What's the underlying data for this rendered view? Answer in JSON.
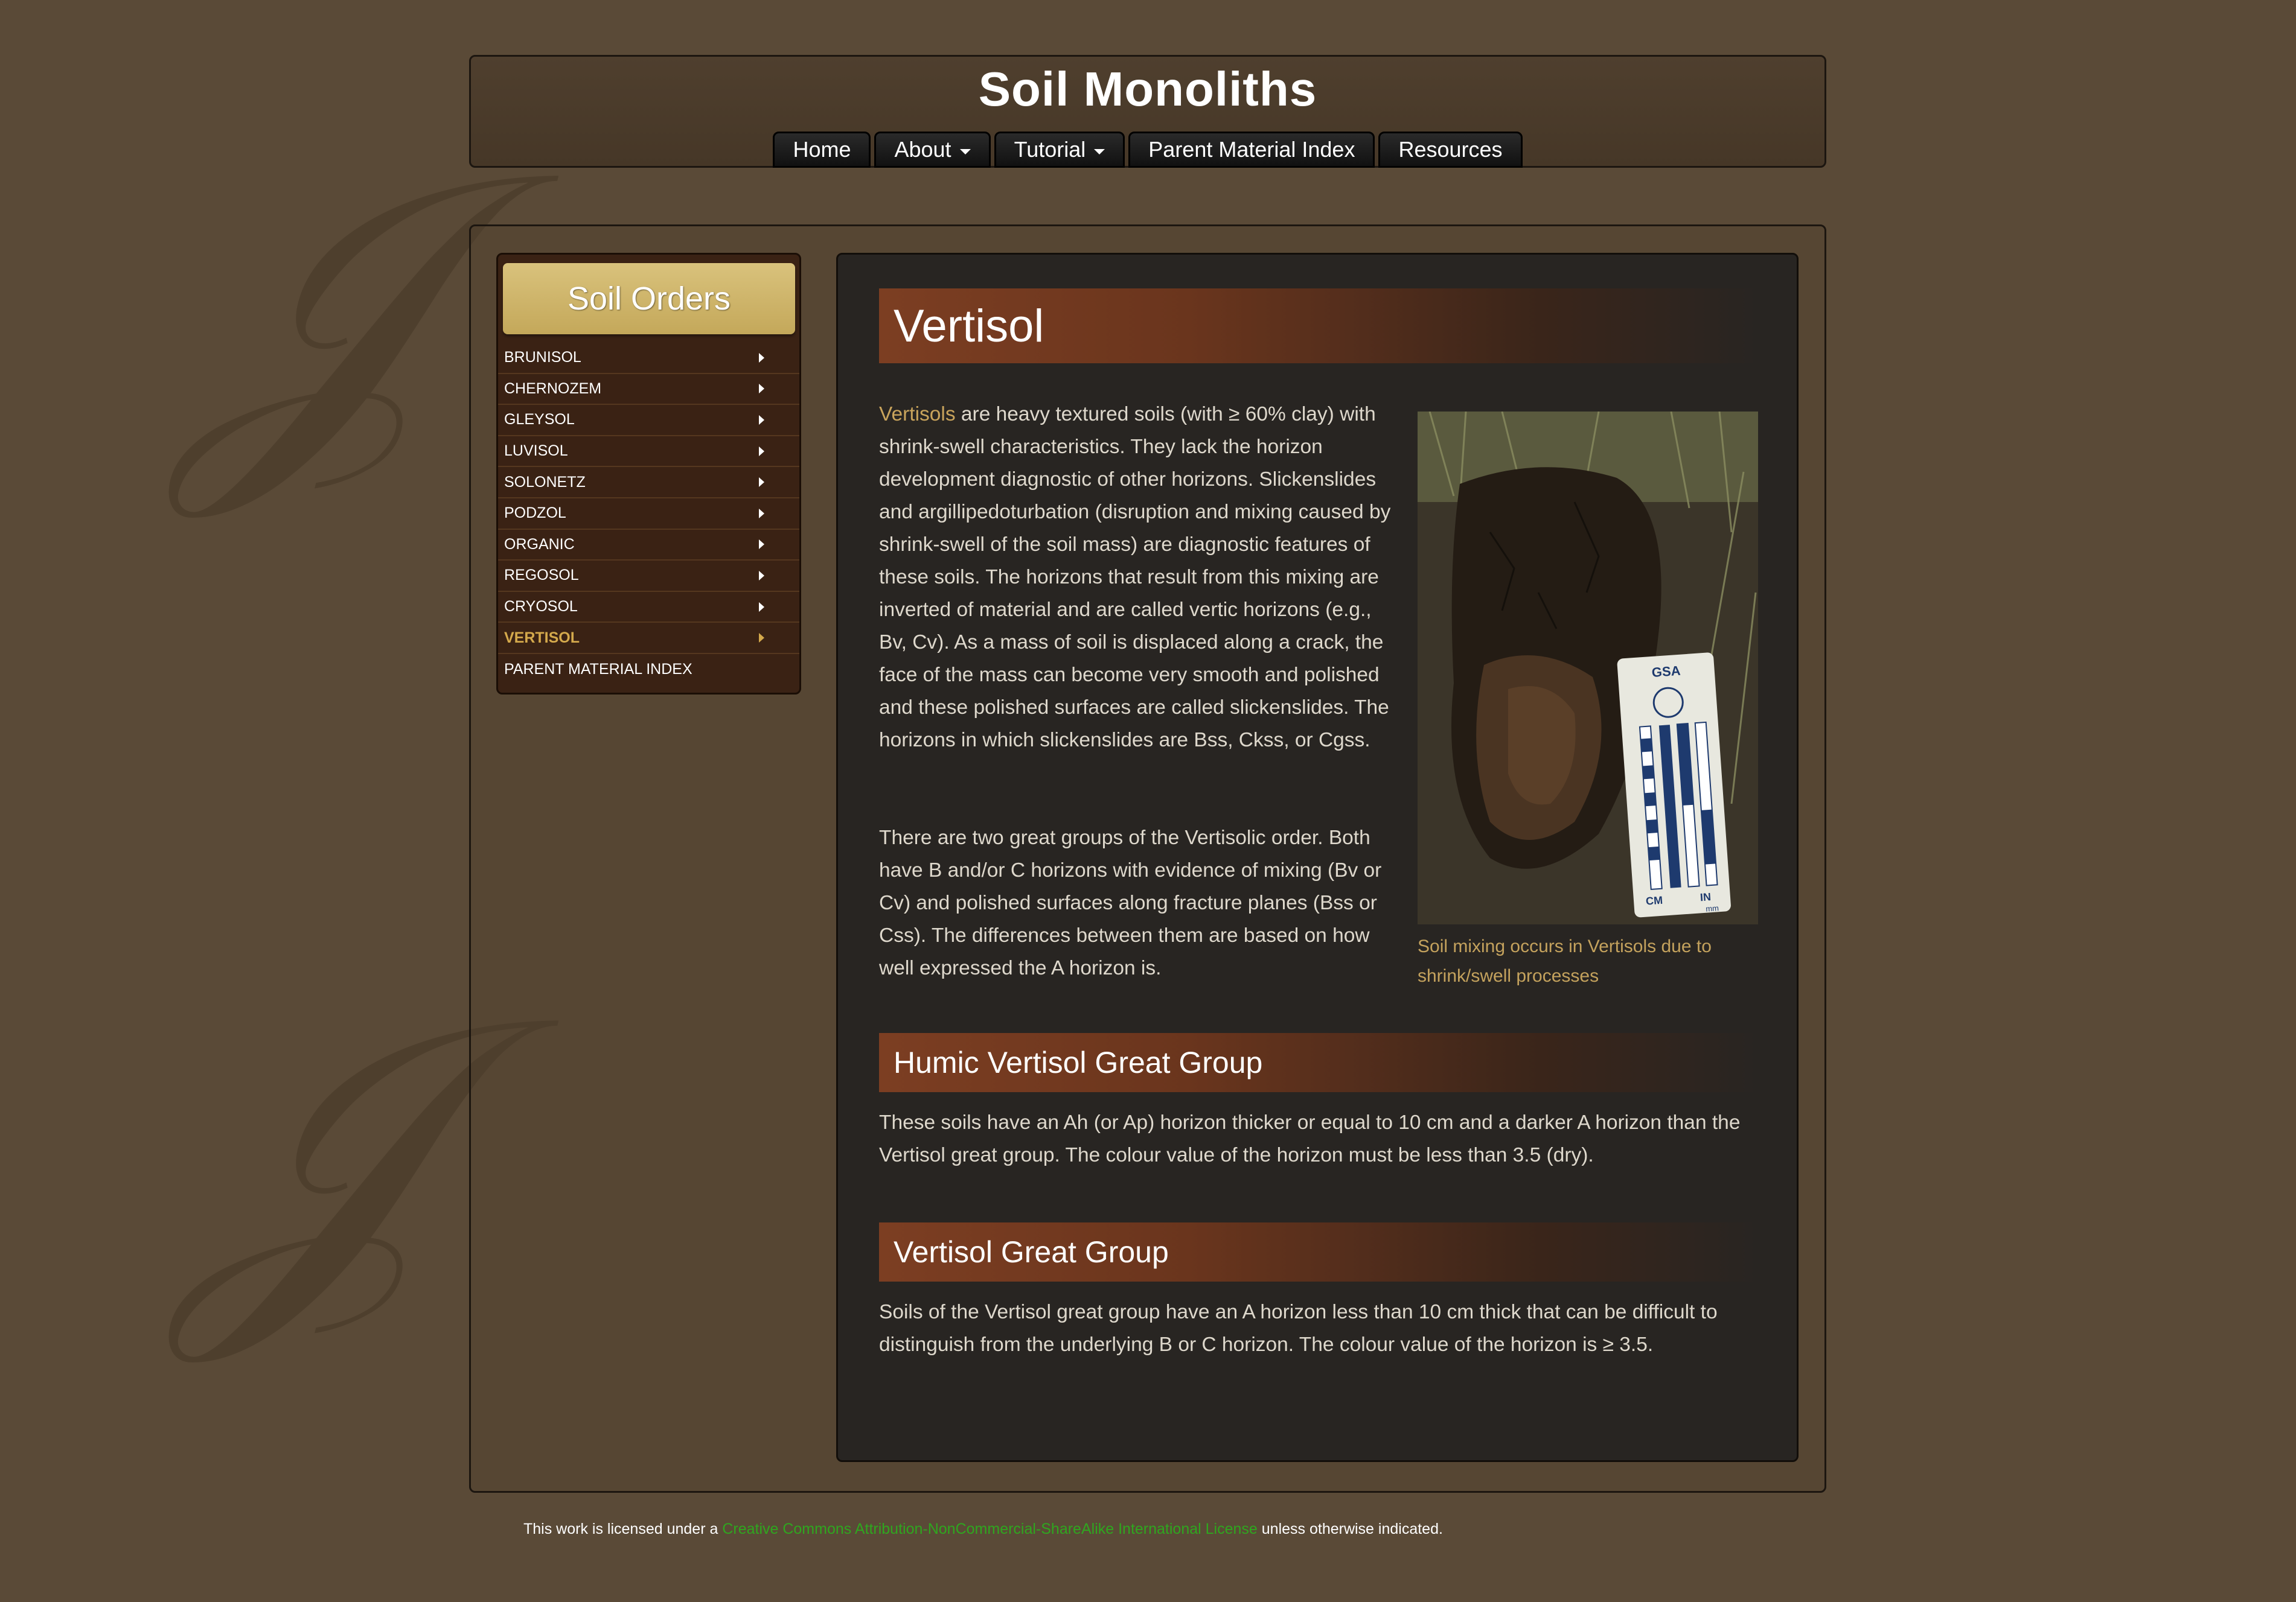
{
  "site": {
    "title": "Soil Monoliths"
  },
  "nav": {
    "items": [
      {
        "label": "Home",
        "dropdown": false
      },
      {
        "label": "About",
        "dropdown": true
      },
      {
        "label": "Tutorial",
        "dropdown": true
      },
      {
        "label": "Parent Material Index",
        "dropdown": false
      },
      {
        "label": "Resources",
        "dropdown": false
      }
    ]
  },
  "sidebar": {
    "heading": "Soil Orders",
    "items": [
      {
        "label": "BRUNISOL",
        "active": false
      },
      {
        "label": "CHERNOZEM",
        "active": false
      },
      {
        "label": "GLEYSOL",
        "active": false
      },
      {
        "label": "LUVISOL",
        "active": false
      },
      {
        "label": "SOLONETZ",
        "active": false
      },
      {
        "label": "PODZOL",
        "active": false
      },
      {
        "label": "ORGANIC",
        "active": false
      },
      {
        "label": "REGOSOL",
        "active": false
      },
      {
        "label": "CRYOSOL",
        "active": false
      },
      {
        "label": "VERTISOL",
        "active": true
      },
      {
        "label": "PARENT MATERIAL INDEX",
        "active": false
      }
    ]
  },
  "content": {
    "title": "Vertisol",
    "intro_link": "Vertisols",
    "intro_rest": " are heavy textured soils (with ≥ 60% clay) with shrink-swell characteristics.  They lack the horizon development diagnostic of other horizons.  Slickenslides and argillipedoturbation (disruption and mixing caused by shrink-swell of the soil mass) are diagnostic features of these soils. The horizons that result from this mixing are inverted of material and are called vertic horizons (e.g., Bv, Cv). As a mass of soil is displaced along a crack, the face of the mass can become very smooth and polished and these polished surfaces are called slickenslides. The horizons in which slickenslides are Bss, Ckss, or Cgss.",
    "para2": "There are two great groups of the Vertisolic order. Both have B and/or C horizons with evidence of mixing (Bv or Cv) and polished surfaces along fracture planes (Bss or Css). The differences between them are based on how well expressed the A horizon is.",
    "photo_caption": "Soil mixing occurs in Vertisols due to shrink/swell processes",
    "photo_scale_label": "GSA",
    "photo_scale_cm": "CM",
    "photo_scale_in": "IN",
    "photo_scale_mm": "mm",
    "section1_title": "Humic Vertisol Great Group",
    "section1_text": "These soils have an Ah (or Ap) horizon thicker or equal to 10 cm and a darker A horizon than the Vertisol great group. The colour value of the horizon must be less than 3.5 (dry).",
    "section2_title": "Vertisol Great Group",
    "section2_text": "Soils of the Vertisol great group have an A horizon less than 10 cm thick that can be difficult to distinguish from the underlying B or C horizon. The colour value of the horizon is ≥ 3.5."
  },
  "footer": {
    "prefix": "This work is licensed under a ",
    "link": "Creative Commons Attribution-NonCommercial-ShareAlike International License",
    "suffix": " unless otherwise indicated."
  },
  "colors": {
    "background": "#5a4a37",
    "accent_gold": "#c4a85a",
    "heading_band": "#7c3e22",
    "link_green": "#2fa61f",
    "active_item": "#d4a94c"
  }
}
